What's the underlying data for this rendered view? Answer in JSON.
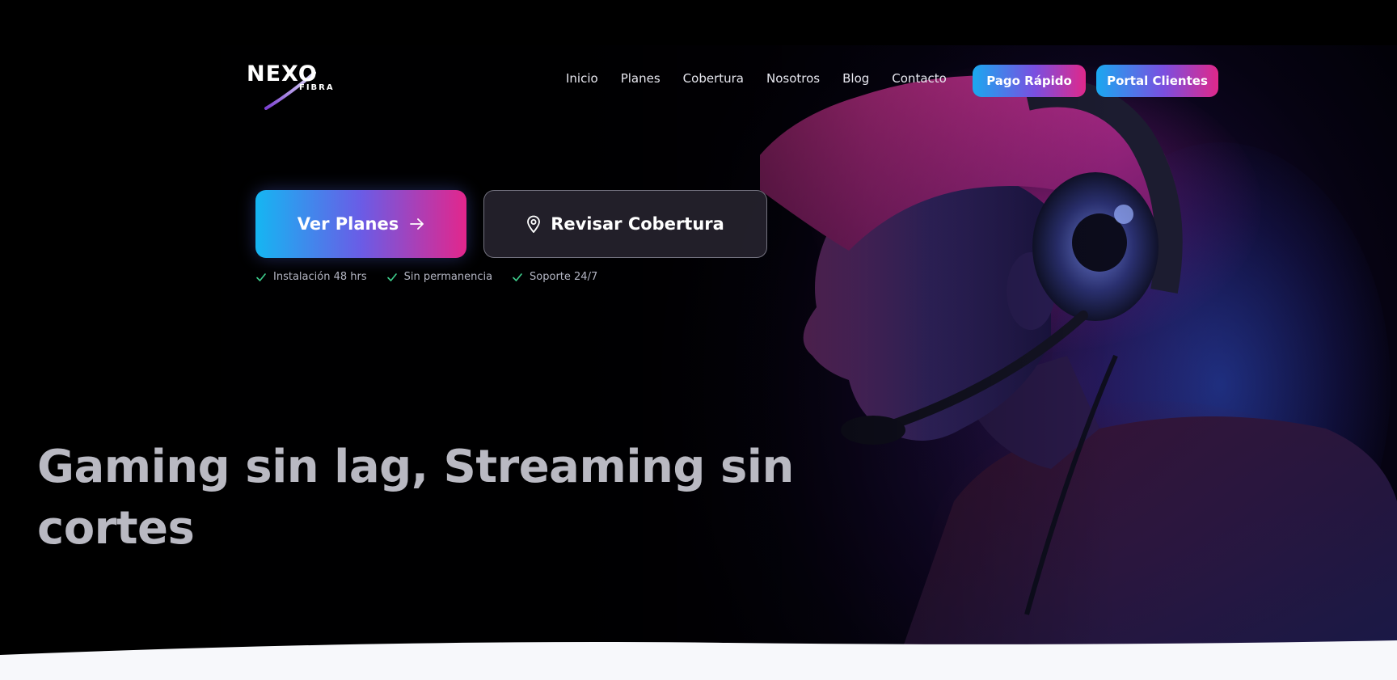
{
  "brand": {
    "logo_main": "NEXO",
    "logo_sub": "FIBRA"
  },
  "nav": {
    "items": [
      {
        "label": "Inicio"
      },
      {
        "label": "Planes"
      },
      {
        "label": "Cobertura"
      },
      {
        "label": "Nosotros"
      },
      {
        "label": "Blog"
      },
      {
        "label": "Contacto"
      }
    ]
  },
  "header_buttons": {
    "pago_label": "Pago Rápido",
    "portal_label": "Portal Clientes"
  },
  "hero": {
    "cta_primary_label": "Ver Planes",
    "cta_secondary_label": "Revisar Cobertura",
    "features": [
      {
        "label": "Instalación 48 hrs"
      },
      {
        "label": "Sin permanencia"
      },
      {
        "label": "Soporte 24/7"
      }
    ],
    "headline": "Gaming sin lag, Streaming sin cortes"
  },
  "colors": {
    "gradient_start": "#15b6f2",
    "gradient_mid": "#6a5ce6",
    "gradient_end": "#e3268c",
    "check_green": "#3ecf8e",
    "page_bottom": "#f7f8fb"
  },
  "icons": {
    "arrow": "arrow-right-icon",
    "location": "map-pin-icon",
    "check": "check-icon"
  }
}
